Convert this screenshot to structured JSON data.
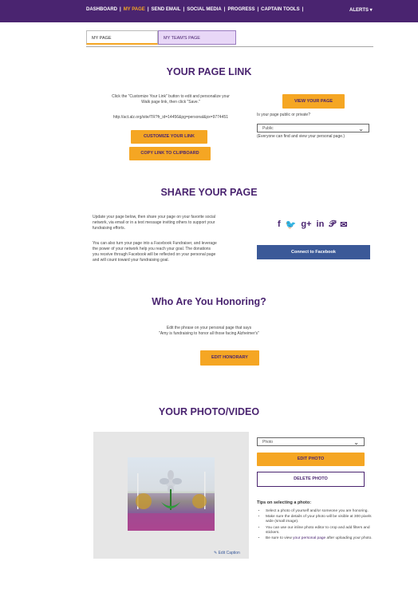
{
  "nav": {
    "items": [
      "DASHBOARD",
      "MY PAGE",
      "SEND EMAIL",
      "SOCIAL MEDIA",
      "PROGRESS",
      "CAPTAIN TOOLS"
    ],
    "alerts": "ALERTS ▾"
  },
  "tabs": {
    "my_page": "MY PAGE",
    "my_teams_page": "MY TEAM'S PAGE"
  },
  "page_link": {
    "title": "YOUR PAGE LINK",
    "instructions_1": "Click the \"Customize Your Link\" button to edit and personalize your",
    "instructions_2": "Walk page link, then click \"Save.\"",
    "url": "http://act.alz.org/site/TR?fr_id=14456&pg=personal&px=9774451",
    "customize_btn": "CUSTOMIZE YOUR LINK",
    "copy_btn": "COPY LINK TO CLIPBOARD",
    "view_btn": "VIEW YOUR PAGE",
    "privacy_question": "Is your page public or private?",
    "privacy_value": "Public",
    "privacy_note": "(Everyone can find and view your personal page.)"
  },
  "share": {
    "title": "SHARE YOUR PAGE",
    "para1": [
      "Update your page below, then share your page on your favorite social",
      "network, via email or in a text message inviting others to support your",
      "fundraising efforts."
    ],
    "para2": [
      "You can also turn your page into a Facebook Fundraiser, and leverage",
      "the power of your network help you reach your goal. The donations",
      "you receive through Facebook will be reflected on your personal page",
      "and will count toward your fundraising goal."
    ],
    "facebook_btn": "Connect to Facebook",
    "icons": [
      "f",
      "🐦",
      "g+",
      "in",
      "𝒫",
      "✉"
    ]
  },
  "honoring": {
    "title": "Who Are You Honoring?",
    "text1": "Edit the phrase on your personal page that says",
    "text2": "\"Amy is fundraising to honor all those facing Alzheimer's\"",
    "edit_btn": "EDIT HONORARY"
  },
  "photo": {
    "title": "YOUR PHOTO/VIDEO",
    "media_select": "Photo",
    "edit_btn": "EDIT PHOTO",
    "delete_btn": "DELETE PHOTO",
    "edit_caption": "Edit Caption",
    "tips_title": "Tips on selecting a photo:",
    "tips": [
      "Select a photo of yourself and/or someone you are honoring.",
      "Make sure the details of your photo will be visible at 300 pixels wide (small image).",
      "You can use our inline photo editor to crop and add filters and stickers."
    ],
    "tip_last_prefix": "Be sure to view ",
    "tip_last_link": "your personal page",
    "tip_last_suffix": " after uploading your photo."
  }
}
